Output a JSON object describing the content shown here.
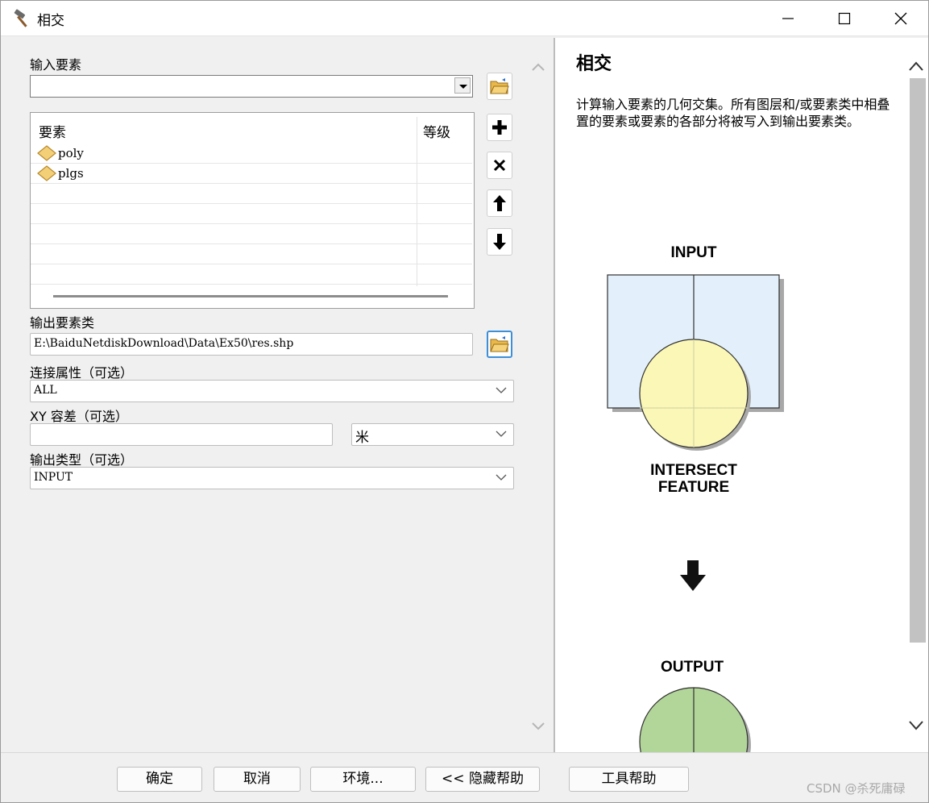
{
  "window": {
    "title": "相交"
  },
  "form": {
    "input_label": "输入要素",
    "input_value": "",
    "table": {
      "col_feature": "要素",
      "col_rank": "等级",
      "rows": [
        {
          "name": "poly",
          "rank": ""
        },
        {
          "name": "plgs",
          "rank": ""
        }
      ]
    },
    "output_label": "输出要素类",
    "output_value": "E:\\BaiduNetdiskDownload\\Data\\Ex50\\res.shp",
    "join_label": "连接属性（可选）",
    "join_value": "ALL",
    "xy_label": "XY 容差（可选）",
    "xy_value": "",
    "xy_unit": "米",
    "type_label": "输出类型（可选）",
    "type_value": "INPUT"
  },
  "help": {
    "title": "相交",
    "description": "计算输入要素的几何交集。所有图层和/或要素类中相叠置的要素或要素的各部分将被写入到输出要素类。",
    "diagram": {
      "input_label": "INPUT",
      "intersect_label_1": "INTERSECT",
      "intersect_label_2": "FEATURE",
      "output_label": "OUTPUT"
    }
  },
  "buttons": {
    "ok": "确定",
    "cancel": "取消",
    "env": "环境...",
    "hide_help": "<< 隐藏帮助",
    "tool_help": "工具帮助"
  },
  "watermark": "CSDN @杀死庸碌",
  "icons": [
    "hammer-icon",
    "minimize-icon",
    "maximize-icon",
    "close-icon",
    "folder-open-icon",
    "add-icon",
    "remove-icon",
    "arrow-up-icon",
    "arrow-down-icon",
    "feature-class-icon",
    "chevron-down-icon"
  ],
  "colors": {
    "input_square": "#e3f0fb",
    "intersect_circle": "#fbf7b7",
    "output_circle": "#b2d59a",
    "focus_border": "#3c8fd8"
  }
}
